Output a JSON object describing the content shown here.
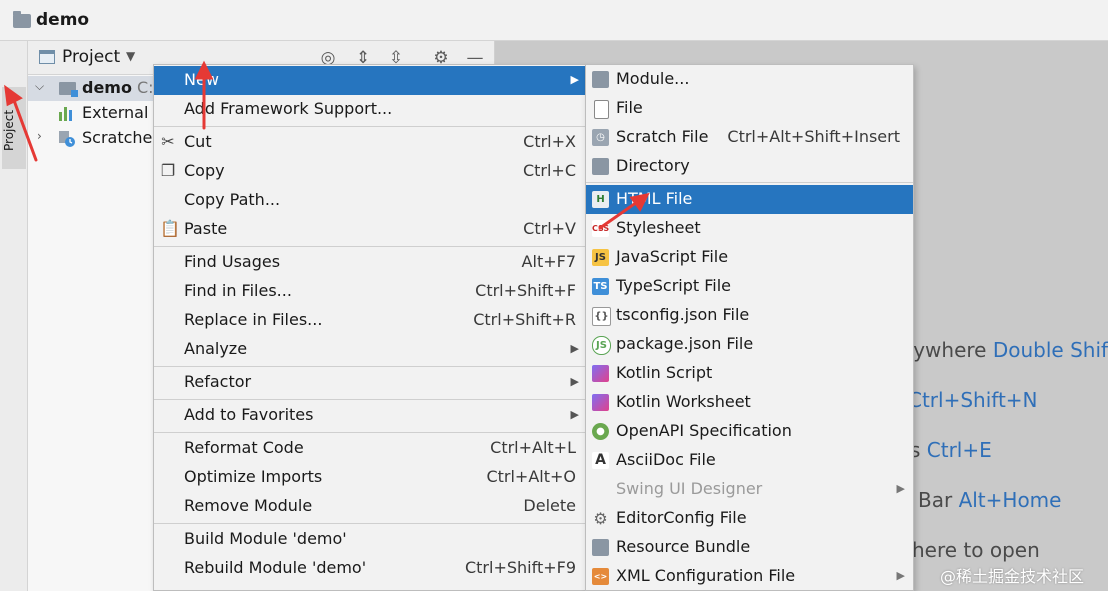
{
  "window": {
    "title": "demo"
  },
  "toolstrip": {
    "project_tab": "Project"
  },
  "panel": {
    "title": "Project",
    "header_icons": [
      "target-icon",
      "expand-all-icon",
      "collapse-all-icon",
      "gear-icon",
      "minimize-icon"
    ],
    "tree": [
      {
        "label": "demo",
        "suffix": "C:",
        "expanded": true,
        "selected": true
      },
      {
        "label": "External L"
      },
      {
        "label": "Scratches",
        "expanded": false
      }
    ]
  },
  "context_menu": {
    "items": [
      {
        "label": "New",
        "shortcut": "",
        "submenu": true,
        "highlighted": true
      },
      {
        "label": "Add Framework Support...",
        "shortcut": ""
      },
      {
        "label": "Cut",
        "shortcut": "Ctrl+X",
        "icon": "scissors-icon"
      },
      {
        "label": "Copy",
        "shortcut": "Ctrl+C",
        "icon": "copy-icon"
      },
      {
        "label": "Copy Path...",
        "shortcut": ""
      },
      {
        "label": "Paste",
        "shortcut": "Ctrl+V",
        "icon": "paste-icon"
      },
      {
        "label": "Find Usages",
        "shortcut": "Alt+F7"
      },
      {
        "label": "Find in Files...",
        "shortcut": "Ctrl+Shift+F"
      },
      {
        "label": "Replace in Files...",
        "shortcut": "Ctrl+Shift+R"
      },
      {
        "label": "Analyze",
        "shortcut": "",
        "submenu": true
      },
      {
        "label": "Refactor",
        "shortcut": "",
        "submenu": true
      },
      {
        "label": "Add to Favorites",
        "shortcut": "",
        "submenu": true
      },
      {
        "label": "Reformat Code",
        "shortcut": "Ctrl+Alt+L"
      },
      {
        "label": "Optimize Imports",
        "shortcut": "Ctrl+Alt+O"
      },
      {
        "label": "Remove Module",
        "shortcut": "Delete"
      },
      {
        "label": "Build Module 'demo'",
        "shortcut": ""
      },
      {
        "label": "Rebuild Module 'demo'",
        "shortcut": "Ctrl+Shift+F9"
      }
    ]
  },
  "new_submenu": {
    "items": [
      {
        "label": "Module...",
        "icon": "module-icon"
      },
      {
        "label": "File",
        "icon": "file-icon"
      },
      {
        "label": "Scratch File",
        "shortcut": "Ctrl+Alt+Shift+Insert",
        "icon": "scratch-file-icon"
      },
      {
        "label": "Directory",
        "icon": "directory-icon"
      },
      {
        "label": "HTML File",
        "icon": "html-file-icon",
        "highlighted": true
      },
      {
        "label": "Stylesheet",
        "icon": "css-icon"
      },
      {
        "label": "JavaScript File",
        "icon": "js-icon"
      },
      {
        "label": "TypeScript File",
        "icon": "ts-icon"
      },
      {
        "label": "tsconfig.json File",
        "icon": "tsconfig-icon"
      },
      {
        "label": "package.json File",
        "icon": "nodejs-icon"
      },
      {
        "label": "Kotlin Script",
        "icon": "kotlin-icon"
      },
      {
        "label": "Kotlin Worksheet",
        "icon": "kotlin-icon"
      },
      {
        "label": "OpenAPI Specification",
        "icon": "openapi-icon"
      },
      {
        "label": "AsciiDoc File",
        "icon": "asciidoc-icon"
      },
      {
        "label": "Swing UI Designer",
        "disabled": true,
        "submenu": true
      },
      {
        "label": "EditorConfig File",
        "icon": "gear-icon"
      },
      {
        "label": "Resource Bundle",
        "icon": "resource-bundle-icon"
      },
      {
        "label": "XML Configuration File",
        "icon": "xml-icon",
        "submenu": true
      }
    ]
  },
  "editor_hints": {
    "h1_text": "rywhere ",
    "h1_key": "Double Shift",
    "h2_key": "Ctrl+Shift+N",
    "h3_text": "s ",
    "h3_key": "Ctrl+E",
    "h4_text": "Bar ",
    "h4_key": "Alt+Home",
    "h5_text": "here to open"
  },
  "watermark": "@稀土掘金技术社区",
  "colors": {
    "highlight": "#2675bf",
    "shortcut_blue": "#2f6fb8",
    "arrow": "#e53935"
  }
}
